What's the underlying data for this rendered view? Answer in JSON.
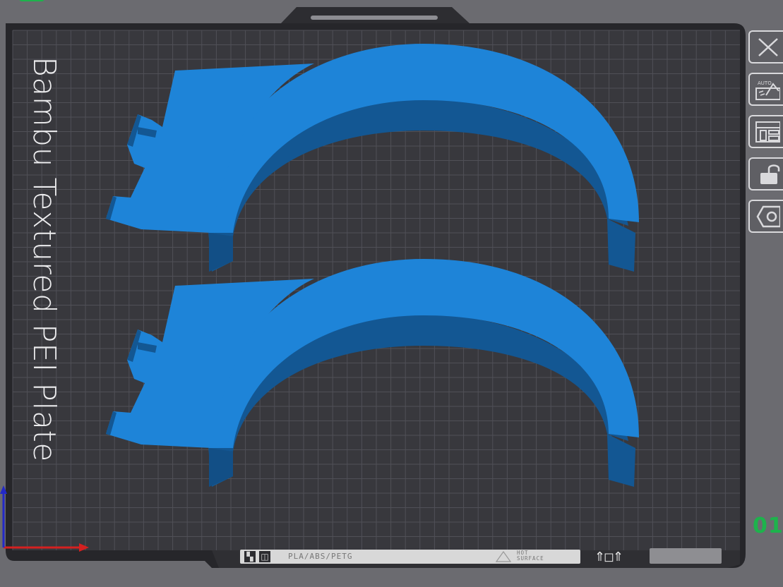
{
  "colors": {
    "background": "#6b6b70",
    "plate": "#38383d",
    "grid_line": "#53535a",
    "plate_border": "#1f1f22",
    "model_top": "#1e84d8",
    "model_side": "#135793",
    "accent_green": "#1db34c",
    "axis_x": "#d42020",
    "axis_y": "#2228c8"
  },
  "plate": {
    "label": "Bambu Textured PEI Plate",
    "number": "01"
  },
  "bottom_strip": {
    "materials": "PLA/ABS/PETG",
    "warning_line1": "HOT",
    "warning_line2": "SURFACE"
  },
  "toolbar": {
    "buttons": [
      {
        "icon": "close-icon"
      },
      {
        "icon": "auto-orient-icon"
      },
      {
        "icon": "arrange-icon"
      },
      {
        "icon": "lock-icon"
      },
      {
        "icon": "settings-hex-icon"
      }
    ]
  },
  "models": [
    {
      "name": "headphone-hanger-part",
      "color": "#1e84d8"
    },
    {
      "name": "headphone-hanger-part",
      "color": "#1e84d8"
    }
  ]
}
